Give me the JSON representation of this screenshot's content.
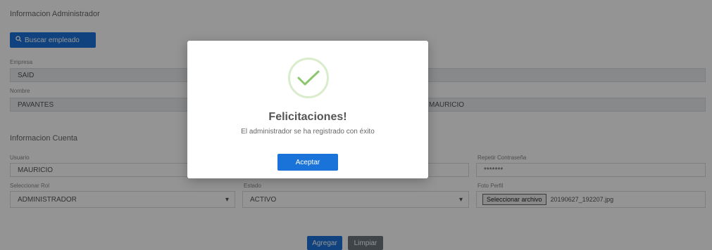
{
  "section_admin": "Informacion Administrador",
  "search_button": "Buscar empleado",
  "fields": {
    "empresa": {
      "label": "Empresa",
      "value": "SAID"
    },
    "nombre": {
      "label": "Nombre",
      "value_left": "PAVANTES",
      "value_right": "MAURICIO"
    }
  },
  "section_account": "Informacion Cuenta",
  "account": {
    "usuario": {
      "label": "Usuario",
      "value": "MAURICIO"
    },
    "repeat_password": {
      "label": "Repetir Contraseña",
      "value": "*******"
    },
    "rol": {
      "label": "Seleccionar Rol",
      "value": "ADMINISTRADOR"
    },
    "estado": {
      "label": "Estado",
      "value": "ACTIVO"
    },
    "foto": {
      "label": "Foto Perfil",
      "button": "Seleccionar archivo",
      "filename": "20190627_192207.jpg"
    }
  },
  "actions": {
    "add": "Agregar",
    "clear": "Limpiar"
  },
  "modal": {
    "title": "Felicitaciones!",
    "message": "El administrador se ha registrado con éxito",
    "accept": "Aceptar",
    "icon": "success-check-icon",
    "accent": "#8cc76f"
  },
  "colors": {
    "primary": "#1a73d9",
    "secondary": "#6c757d",
    "overlay": "rgba(0,0,0,0.42)"
  }
}
